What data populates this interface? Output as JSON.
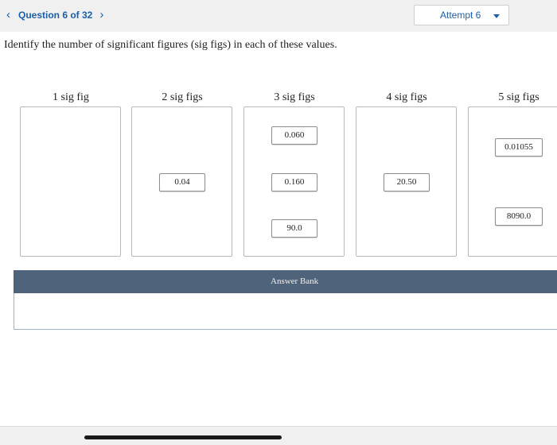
{
  "header": {
    "prev_icon": "‹",
    "question_label": "Question 6 of 32",
    "next_icon": "›",
    "attempt_label": "Attempt 6"
  },
  "prompt": "Identify the number of significant figures (sig figs) in each of these values.",
  "bins": [
    {
      "label": "1 sig fig",
      "items": []
    },
    {
      "label": "2 sig figs",
      "items": [
        "0.04"
      ]
    },
    {
      "label": "3 sig figs",
      "items": [
        "0.060",
        "0.160",
        "90.0"
      ]
    },
    {
      "label": "4 sig figs",
      "items": [
        "20.50"
      ]
    },
    {
      "label": "5 sig figs",
      "items": [
        "0.01055",
        "8090.0"
      ]
    }
  ],
  "answer_bank": {
    "title": "Answer Bank",
    "items": []
  },
  "colors": {
    "accent": "#1b5fa8",
    "bank_header": "#4f637a",
    "topbar": "#f0f0f0"
  }
}
